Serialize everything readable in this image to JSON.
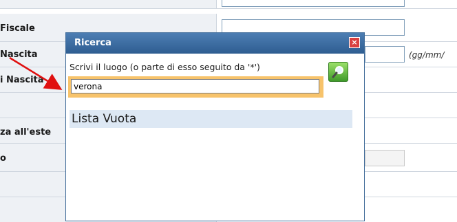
{
  "form": {
    "rows": [
      {
        "label": "",
        "key": "row-top"
      },
      {
        "label": "Fiscale",
        "key": "codice-fiscale"
      },
      {
        "label": "Nascita",
        "key": "data-nascita",
        "hint": "(gg/mm/"
      },
      {
        "label": "i Nascita",
        "key": "luogo-nascita"
      },
      {
        "label": "",
        "key": "row-blank"
      },
      {
        "label": "za all'este",
        "key": "residenza-estero"
      },
      {
        "label": "o",
        "key": "row-o"
      },
      {
        "label": "",
        "key": "row-e"
      }
    ]
  },
  "modal": {
    "title": "Ricerca",
    "close_symbol": "×",
    "instructions": "Scrivi il luogo (o parte di esso seguito da '*')",
    "search_value": "verona",
    "search_icon": "magnifier-icon",
    "result_text": "Lista Vuota"
  },
  "colors": {
    "header": "#2e5d91",
    "input_highlight": "#f7c36b",
    "result_row": "#dde8f4",
    "arrow": "#e01010"
  }
}
